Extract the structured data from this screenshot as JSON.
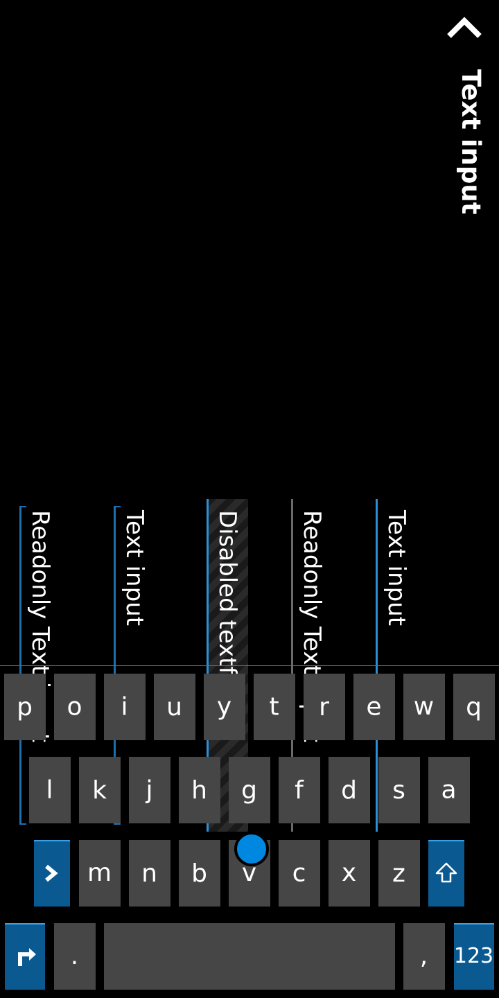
{
  "header": {
    "title": "Text input"
  },
  "fields": [
    {
      "value": "Text input"
    },
    {
      "value": "Readonly Text input"
    },
    {
      "value": "Disabled textfield"
    },
    {
      "value": "Text input"
    },
    {
      "value": "Readonly Text input"
    }
  ],
  "keyboard": {
    "row1": [
      "q",
      "w",
      "e",
      "r",
      "t",
      "y",
      "u",
      "i",
      "o",
      "p"
    ],
    "row2": [
      "a",
      "s",
      "d",
      "f",
      "g",
      "h",
      "j",
      "k",
      "l"
    ],
    "row3": [
      "z",
      "x",
      "c",
      "v",
      "b",
      "n",
      "m"
    ],
    "row4": {
      "symbols_label": "123",
      "comma": ",",
      "period": "."
    },
    "icons": {
      "shift": "shift-arrow-icon",
      "backspace": "backspace-icon",
      "enter": "enter-return-icon"
    }
  },
  "colors": {
    "accent": "#2d8fd6",
    "key_bg": "#464646",
    "key_special": "#0a5a91",
    "cursor": "#0088e0"
  }
}
